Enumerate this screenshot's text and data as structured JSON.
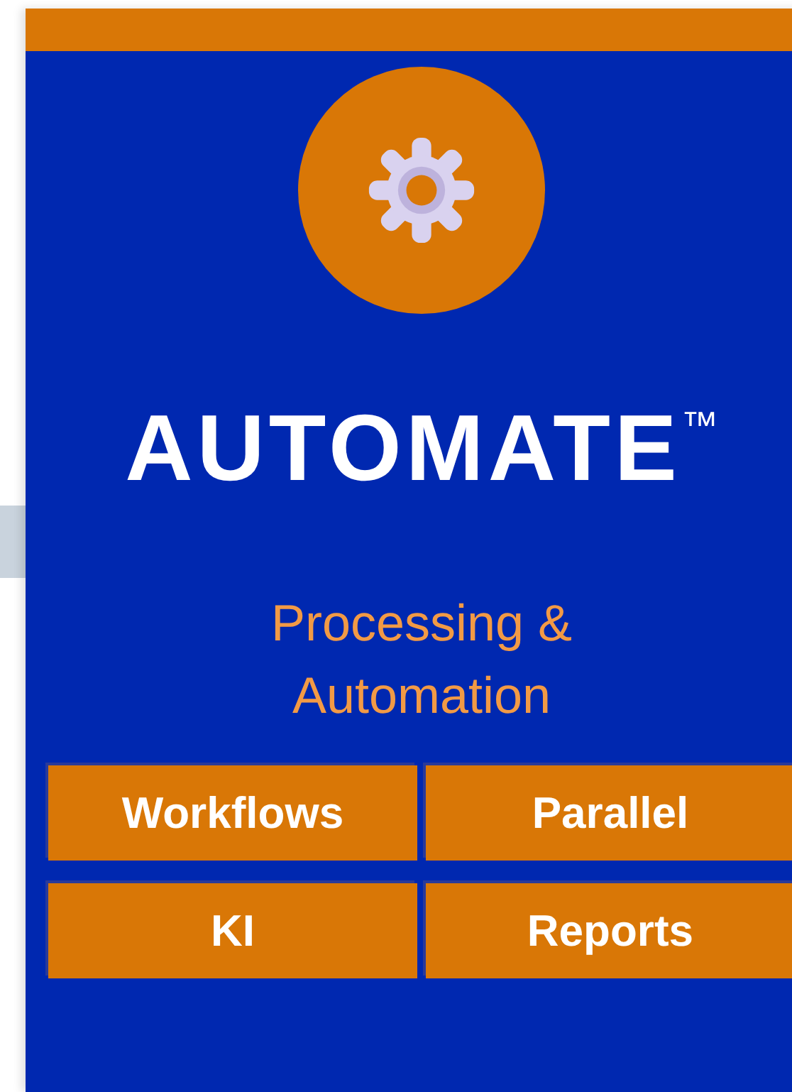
{
  "logo": {
    "title": "AUTOMATE$^{™}$",
    "subtitle": "Processing & Automation"
  },
  "buttons": [
    {
      "label": "Workflows"
    },
    {
      "label": "Parallel"
    },
    {
      "label": "KI"
    },
    {
      "label": "Reports"
    }
  ]
}
